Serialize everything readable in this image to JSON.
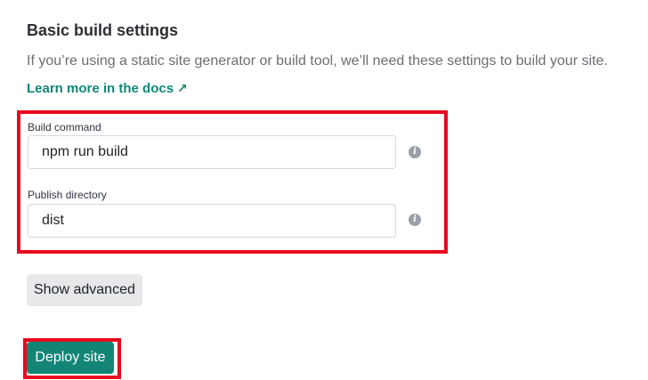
{
  "section": {
    "title": "Basic build settings",
    "description": "If you’re using a static site generator or build tool, we’ll need these settings to build your site.",
    "docs_link": {
      "label": "Learn more in the docs",
      "arrow": "↗"
    }
  },
  "fields": {
    "build_command": {
      "label": "Build command",
      "value": "npm run build",
      "info_icon": "info-icon"
    },
    "publish_directory": {
      "label": "Publish directory",
      "value": "dist",
      "info_icon": "info-icon"
    }
  },
  "buttons": {
    "show_advanced": "Show advanced",
    "deploy": "Deploy site"
  },
  "colors": {
    "accent": "#138576",
    "highlight": "#e8091e",
    "secondary_button": "#e6e8ea"
  }
}
